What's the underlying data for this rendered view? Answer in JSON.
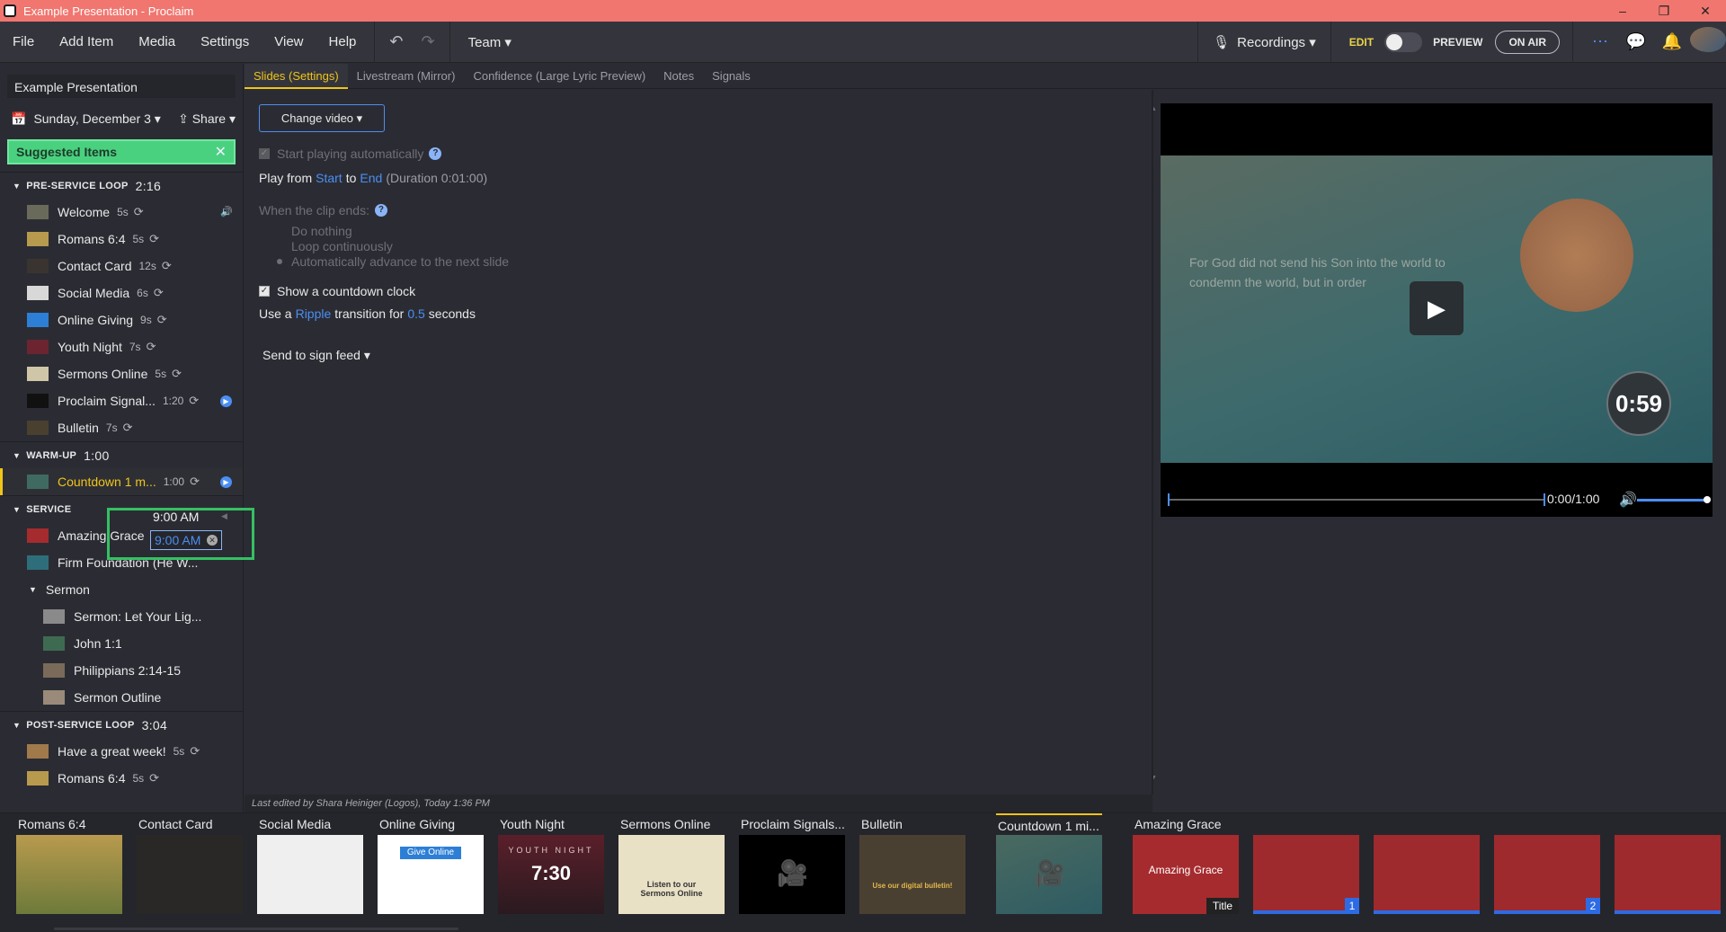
{
  "window": {
    "title": "Example Presentation - Proclaim",
    "min": "–",
    "max": "❐",
    "close": "✕"
  },
  "menu": {
    "items": [
      "File",
      "Add Item",
      "Media",
      "Settings",
      "View",
      "Help"
    ],
    "undo": "↶",
    "redo": "↷",
    "team": "Team ▾",
    "recordings": "Recordings ▾",
    "edit": "EDIT",
    "preview": "PREVIEW",
    "on_air": "ON AIR"
  },
  "sidebar": {
    "presentation_name": "Example Presentation",
    "date": "Sunday, December 3 ▾",
    "share": "Share ▾",
    "suggested": "Suggested Items",
    "sections": [
      {
        "title": "PRE-SERVICE LOOP",
        "duration": "2:16",
        "items": [
          {
            "name": "Welcome",
            "dur": "5s",
            "thumb": "#6a6a5a"
          },
          {
            "name": "Romans 6:4",
            "dur": "5s",
            "thumb": "#b89a4e"
          },
          {
            "name": "Contact Card",
            "dur": "12s",
            "thumb": "#3a3430"
          },
          {
            "name": "Social Media",
            "dur": "6s",
            "thumb": "#d8d8d8"
          },
          {
            "name": "Online Giving",
            "dur": "9s",
            "thumb": "#2d7fd6"
          },
          {
            "name": "Youth Night",
            "dur": "7s",
            "thumb": "#6b2430"
          },
          {
            "name": "Sermons Online",
            "dur": "5s",
            "thumb": "#cfc6a8"
          },
          {
            "name": "Proclaim Signal...",
            "dur": "1:20",
            "thumb": "#111111"
          },
          {
            "name": "Bulletin",
            "dur": "7s",
            "thumb": "#4a4030"
          }
        ]
      },
      {
        "title": "WARM-UP",
        "duration": "1:00",
        "items": [
          {
            "name": "Countdown 1 m...",
            "dur": "1:00",
            "thumb": "#3f6a62"
          }
        ]
      },
      {
        "title": "SERVICE",
        "duration": "",
        "items": [
          {
            "name": "Amazing Grace",
            "dur": "",
            "thumb": "#a62b2e"
          },
          {
            "name": "Firm Foundation (He W...",
            "dur": "",
            "thumb": "#2e6e7a"
          }
        ]
      },
      {
        "title": "POST-SERVICE LOOP",
        "duration": "3:04",
        "items": [
          {
            "name": "Have a great week!",
            "dur": "5s",
            "thumb": "#a07a4a"
          },
          {
            "name": "Romans 6:4",
            "dur": "5s",
            "thumb": "#b89a4e"
          }
        ]
      }
    ],
    "sermon_group": "Sermon",
    "sermon_items": [
      {
        "name": "Sermon: Let Your Lig...",
        "thumb": "#8a8a8a"
      },
      {
        "name": "John 1:1",
        "thumb": "#3f6a52"
      },
      {
        "name": "Philippians 2:14-15",
        "thumb": "#7a6a5a"
      },
      {
        "name": "Sermon Outline",
        "thumb": "#9a8a7a"
      }
    ],
    "service_time_label": "9:00 AM",
    "service_time_input": "9:00 AM"
  },
  "tabs": [
    "Slides (Settings)",
    "Livestream (Mirror)",
    "Confidence (Large Lyric Preview)",
    "Notes",
    "Signals"
  ],
  "settings": {
    "change_video": "Change video ▾",
    "start_auto": "Start playing automatically",
    "play_from": "Play from",
    "start": "Start",
    "to": "to",
    "end": "End",
    "duration": "(Duration 0:01:00)",
    "clip_ends": "When the clip ends:",
    "opt_nothing": "Do nothing",
    "opt_loop": "Loop continuously",
    "opt_advance": "Automatically advance to the next slide",
    "countdown_clock": "Show a countdown clock",
    "use_a": "Use a",
    "ripple": "Ripple",
    "transition_for": "transition for",
    "seconds_val": "0.5",
    "seconds": "seconds",
    "send_sign": "Send to sign feed ▾"
  },
  "preview": {
    "verse": "For God did not send his Son into the world to condemn the world, but in order",
    "countdown": "0:59",
    "time": "0:00/1:00",
    "progress": 0.0,
    "volume": 1.0
  },
  "last_edited": "Last edited by Shara Heiniger (Logos), Today 1:36 PM",
  "strip": [
    {
      "label": "Romans 6:4",
      "bg": "linear-gradient(180deg,#b89a4e,#6d7a3a)"
    },
    {
      "label": "Contact Card",
      "bg": "#2a2826"
    },
    {
      "label": "Social Media",
      "bg": "#efefef"
    },
    {
      "label": "Online Giving",
      "bg": "#ffffff"
    },
    {
      "label": "Youth Night",
      "bg": "linear-gradient(180deg,#5a1f2a,#2a1a20)"
    },
    {
      "label": "Sermons Online",
      "bg": "#e9e1c6"
    },
    {
      "label": "Proclaim Signals...",
      "bg": "#000000"
    },
    {
      "label": "Bulletin",
      "bg": "#4a4032"
    },
    {
      "label": "Countdown 1 mi...",
      "bg": "linear-gradient(160deg,#4a6a60,#2d5b63)"
    },
    {
      "label": "Amazing Grace",
      "bg": "#a62b2e"
    },
    {
      "label": "",
      "bg": "#9e2a2d"
    },
    {
      "label": "",
      "bg": "#9e2a2d"
    },
    {
      "label": "",
      "bg": "#9e2a2d"
    },
    {
      "label": "",
      "bg": "#9e2a2d"
    }
  ],
  "strip_text": {
    "giving_btn": "Give Online",
    "youth_big": "7:30",
    "youth_word": "YOUTH NIGHT",
    "sermons_txt": "Listen to our Sermons Online",
    "bulletin_txt": "Use our digital bulletin!",
    "ag_title": "Amazing Grace",
    "ag_tag": "Title",
    "ag_num1": "1",
    "ag_num2": "2"
  }
}
